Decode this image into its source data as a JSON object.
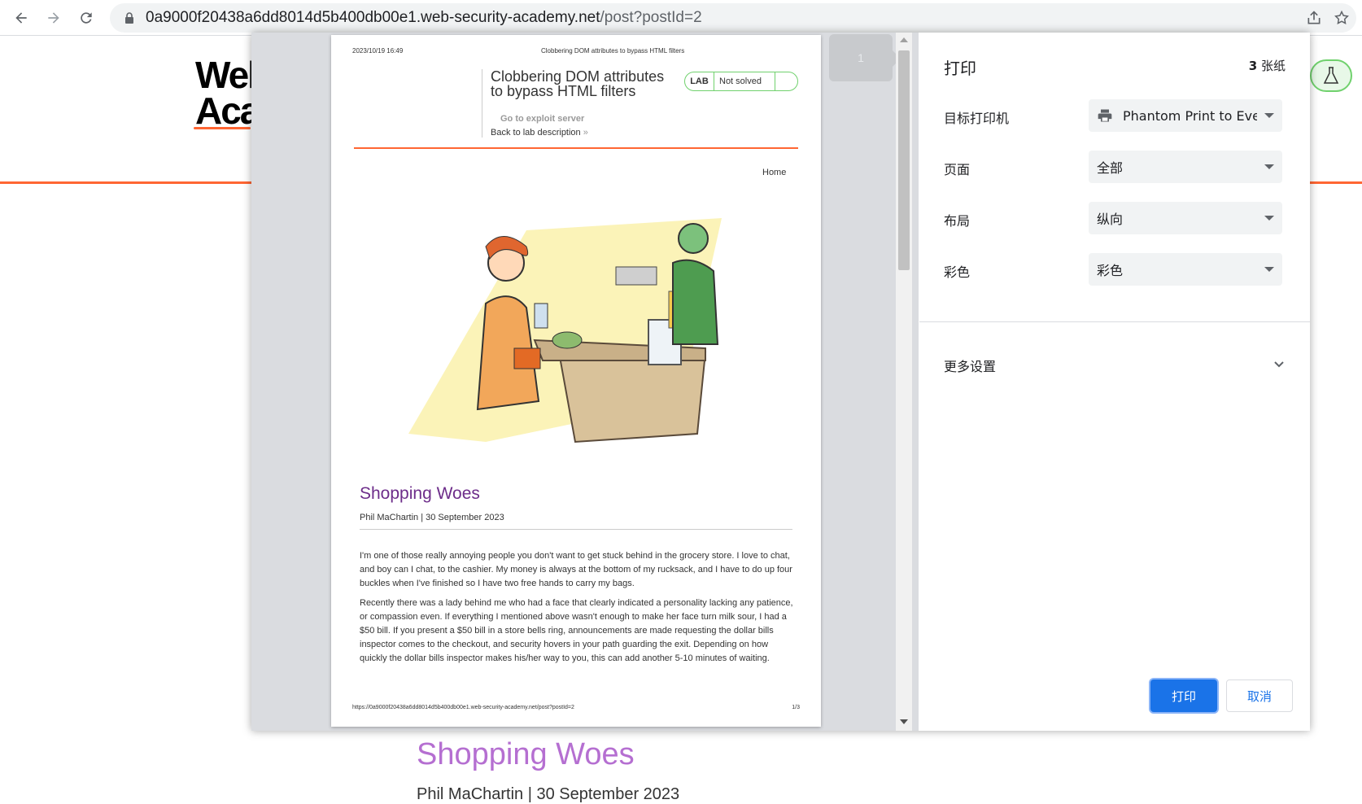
{
  "browser": {
    "url_host": "0a9000f20438a6dd8014d5b400db00e1.web-security-academy.net",
    "url_path": "/post?postId=2"
  },
  "background_page": {
    "logo_line1": "Wel",
    "logo_line2": "Aca",
    "post_title": "Shopping Woes",
    "post_author": "Phil MaChartin | 30 September 2023"
  },
  "preview": {
    "page_number": "1",
    "paper": {
      "header_date": "2023/10/19 16:49",
      "header_title": "Clobbering DOM attributes to bypass HTML filters",
      "lab_title": "Clobbering DOM attributes to bypass HTML filters",
      "lab_badge": "LAB",
      "lab_status": "Not solved",
      "exploit_link": "Go to exploit server",
      "back_link": "Back to lab description",
      "back_chevron": "»",
      "home_link": "Home",
      "post_title": "Shopping Woes",
      "post_author": "Phil MaChartin | 30 September 2023",
      "paragraphs": [
        "I'm one of those really annoying people you don't want to get stuck behind in the grocery store. I love to chat, and boy can I chat, to the cashier. My money is always at the bottom of my rucksack, and I have to do up four buckles when I've finished so I have two free hands to carry my bags.",
        "Recently there was a lady behind me who had a face that clearly indicated a personality lacking any patience, or compassion even. If everything I mentioned above wasn't enough to make her face turn milk sour, I had a $50 bill. If you present a $50 bill in a store bells ring, announcements are made requesting the dollar bills inspector comes to the checkout, and security hovers in your path guarding the exit. Depending on how quickly the dollar bills inspector makes his/her way to you, this can add another 5-10 minutes of waiting."
      ],
      "footer_url": "https://0a9000f20438a6dd8014d5b400db00e1.web-security-academy.net/post?postId=2",
      "footer_page": "1/3"
    }
  },
  "settings": {
    "title": "打印",
    "sheets_count": "3",
    "sheets_unit": "张纸",
    "rows": [
      {
        "label": "目标打印机",
        "value": "Phantom Print to Everr"
      },
      {
        "label": "页面",
        "value": "全部"
      },
      {
        "label": "布局",
        "value": "纵向"
      },
      {
        "label": "彩色",
        "value": "彩色"
      }
    ],
    "more_settings": "更多设置",
    "print_button": "打印",
    "cancel_button": "取消"
  },
  "colors": {
    "accent_blue": "#1a73e8",
    "portswigger_orange": "#ff6633",
    "lab_green": "#70d16d",
    "post_title_purple": "#6d2d8a"
  }
}
